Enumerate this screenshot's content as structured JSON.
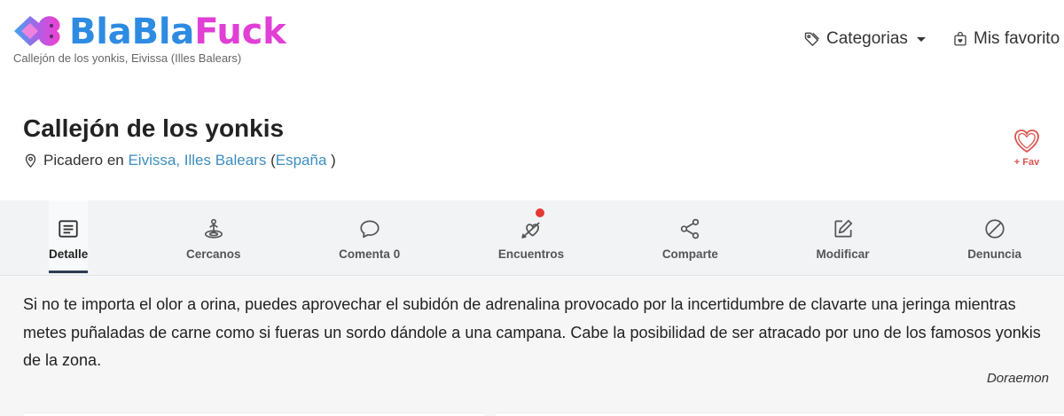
{
  "header": {
    "logo": {
      "icon": "logo-heart-bubble-icon",
      "part1": "BlaBla",
      "part2": "Fuck",
      "part1_color": "#2e8be2",
      "part2_color": "#e13fd6"
    },
    "subtitle": "Callejón de los yonkis, Eivissa (Illes Balears)",
    "nav": {
      "categories": {
        "icon": "tag-icon",
        "label": "Categorias",
        "dropdown": true
      },
      "favorites": {
        "icon": "favorites-bag-icon",
        "label": "Mis favorito"
      }
    }
  },
  "place": {
    "title": "Callejón de los yonkis",
    "location_icon": "map-pin-icon",
    "type_prefix": "Picadero en",
    "location_link": "Eivissa, Illes Balears",
    "paren_open": "(",
    "country_link": "España",
    "paren_close": ")",
    "fav": {
      "icon": "heart-icon",
      "label": "+ Fav"
    }
  },
  "tabs": [
    {
      "label": "Detalle",
      "icon": "detail-list-icon",
      "active": true
    },
    {
      "label": "Cercanos",
      "icon": "nearby-person-icon"
    },
    {
      "label": "Comenta",
      "count": 0,
      "icon": "comment-bubble-icon"
    },
    {
      "label": "Encuentros",
      "icon": "cupid-heart-icon",
      "notification": true
    },
    {
      "label": "Comparte",
      "icon": "share-icon"
    },
    {
      "label": "Modificar",
      "icon": "edit-icon"
    },
    {
      "label": "Denuncia",
      "icon": "ban-icon"
    }
  ],
  "description": {
    "text": "Si no te importa el olor a orina, puedes aprovechar el subidón de adrenalina provocado por la incertidumbre de clavarte una jeringa mientras metes puñaladas de carne como si fueras un sordo dándole a una campana. Cabe la posibilidad de ser atracado por uno de los famosos yonkis de la zona.",
    "author": "Doraemon"
  },
  "colors": {
    "link": "#3d8dbf",
    "fav_red": "#d9534f",
    "active_tab_underline": "#2c3e50",
    "notification_dot": "#e53935",
    "tab_bar_bg": "#f2f3f5",
    "description_bg": "#f6f6f7"
  }
}
